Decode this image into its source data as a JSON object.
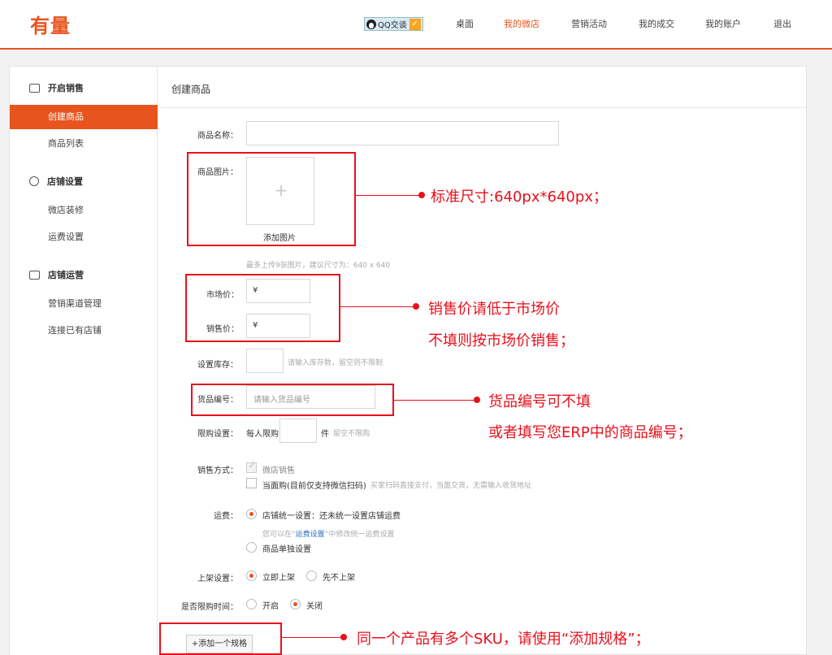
{
  "header": {
    "logo": "有量",
    "qq_label": "QQ交谈",
    "nav": [
      "桌面",
      "我的微店",
      "营销活动",
      "我的成交",
      "我的账户",
      "退出"
    ]
  },
  "sidebar": {
    "group1": "开启销售",
    "group1_items": [
      "创建商品",
      "商品列表"
    ],
    "group2": "店铺设置",
    "group2_items": [
      "微店装修",
      "运费设置"
    ],
    "group3": "店铺运营",
    "group3_items": [
      "营销渠道管理",
      "连接已有店铺"
    ]
  },
  "content": {
    "title": "创建商品",
    "name_label": "商品名称：",
    "image_label": "商品图片：",
    "add_image": "添加图片",
    "image_hint": "最多上传9张图片，建议尺寸为：640 x 640",
    "market_price_label": "市场价：",
    "sale_price_label": "销售价：",
    "currency": "¥",
    "stock_label": "设置库存：",
    "stock_hint": "请输入库存数，留空则不限制",
    "sku_label": "货品编号：",
    "sku_placeholder": "请输入货品编号",
    "limit_label": "限购设置：",
    "limit_prefix": "每人限购",
    "limit_unit": "件",
    "limit_hint": "留空不限购",
    "sale_mode_label": "销售方式：",
    "sale_mode_1": "微店销售",
    "sale_mode_2": "当面购(目前仅支持微信扫码)",
    "sale_mode_2_hint": "买家扫码直接支付，当面交货，无需输入收货地址",
    "shipping_label": "运费：",
    "shipping_1": "店铺统一设置：还未统一设置店铺运费",
    "shipping_hint_pre": "您可以在“",
    "shipping_hint_link": "运费设置",
    "shipping_hint_post": "”中修改统一运费设置",
    "shipping_2": "商品单独设置",
    "listing_label": "上架设置：",
    "listing_1": "立即上架",
    "listing_2": "先不上架",
    "timelimit_label": "是否限购时间：",
    "timelimit_1": "开启",
    "timelimit_2": "关闭",
    "add_spec_button": "+添加一个规格"
  },
  "annotations": {
    "note1": "标准尺寸:640px*640px；",
    "note2_line1": "销售价请低于市场价",
    "note2_line2": "不填则按市场价销售；",
    "note3_line1": "货品编号可不填",
    "note3_line2": "或者填写您ERP中的商品编号；",
    "note4": "同一个产品有多个SKU，请使用“添加规格”；"
  },
  "colors": {
    "brand": "#e8541e",
    "annotation": "#e8101c"
  }
}
